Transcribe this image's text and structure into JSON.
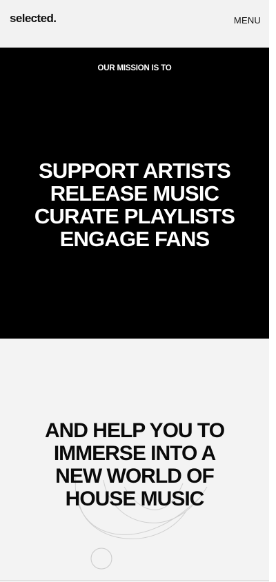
{
  "header": {
    "logo_text": "selected.",
    "menu_label": "MENU"
  },
  "mission": {
    "eyebrow": "OUR MISSION IS TO",
    "lines": [
      "SUPPORT ARTISTS",
      "RELEASE MUSIC",
      "CURATE PLAYLISTS",
      "ENGAGE FANS"
    ]
  },
  "immerse": {
    "lines": [
      "AND HELP YOU TO",
      "IMMERSE INTO A",
      "NEW WORLD OF",
      "HOUSE MUSIC"
    ]
  },
  "colors": {
    "page_background": "#f1f1f1",
    "mission_background": "#000000",
    "mission_text": "#ffffff",
    "heading_text": "#0a0a0a"
  }
}
